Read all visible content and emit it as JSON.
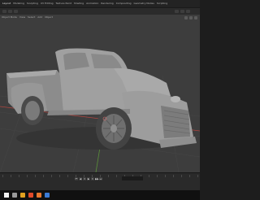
{
  "app": {
    "tabs": [
      "Layout",
      "Modeling",
      "Sculpting",
      "UV Editing",
      "Texture Paint",
      "Shading",
      "Animation",
      "Rendering",
      "Compositing",
      "Geometry Nodes",
      "Scripting"
    ],
    "active_tab_index": 0
  },
  "viewport": {
    "header_items": [
      "Object Mode",
      "View",
      "Select",
      "Add",
      "Object"
    ]
  },
  "timeline": {
    "transport": [
      "⏮",
      "◀",
      "⏴",
      "▶",
      "⏵",
      "▶▶",
      "⏭"
    ],
    "frame_value": ""
  },
  "taskbar": {
    "icons": [
      "start-icon",
      "search-icon",
      "explorer-icon",
      "chrome-icon",
      "blender-icon",
      "photoshop-icon"
    ],
    "colors": [
      "#f2f2f2",
      "#9a9a9a",
      "#e0a020",
      "#e04a2a",
      "#e6772e",
      "#3b7bd6"
    ]
  },
  "colors": {
    "viewport_bg": "#3d3d3d",
    "truck_body": "#9a9a9a",
    "grid_red": "#b0453f",
    "grid_green": "#5a8f3a"
  }
}
